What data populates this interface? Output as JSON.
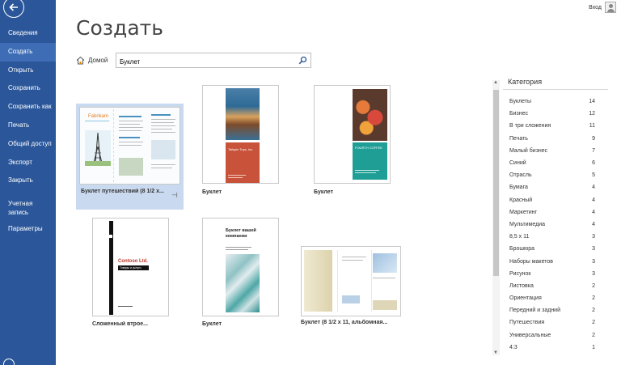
{
  "window": {
    "signin_label": "Вход"
  },
  "sidebar": {
    "items": [
      {
        "label": "Сведения"
      },
      {
        "label": "Создать",
        "active": true
      },
      {
        "label": "Открыть"
      },
      {
        "label": "Сохранить"
      },
      {
        "label": "Сохранить как"
      },
      {
        "label": "Печать"
      },
      {
        "label": "Общий доступ"
      },
      {
        "label": "Экспорт"
      },
      {
        "label": "Закрыть"
      },
      {
        "label": "Учетная запись",
        "two_line": true
      },
      {
        "label": "Параметры"
      }
    ]
  },
  "main": {
    "title": "Создать",
    "home_label": "Домой",
    "search_value": "Буклет",
    "templates": [
      {
        "caption": "Буклет путешествий (8 1/2 x...",
        "selected": true
      },
      {
        "caption": "Буклет"
      },
      {
        "caption": "Буклет"
      },
      {
        "caption": "Сложенный втрое..."
      },
      {
        "caption": "Буклет"
      },
      {
        "caption": "Буклет (8 1/2 x 11, альбомная..."
      }
    ],
    "thumb_text": {
      "fabrikam": "Fabrikam",
      "tailspin": "Tailspin Toys, Inc.",
      "fourth_coffee": "FOURTH COFFEE",
      "contoso": "Contoso Ltd.",
      "contoso_sub": "Товары и услуги",
      "booklet_heading": "Буклет вашей компании"
    }
  },
  "categories": {
    "title": "Категория",
    "items": [
      {
        "name": "Буклеты",
        "count": "14"
      },
      {
        "name": "Бизнес",
        "count": "12"
      },
      {
        "name": "В три сложения",
        "count": "11"
      },
      {
        "name": "Печать",
        "count": "9"
      },
      {
        "name": "Малый бизнес",
        "count": "7"
      },
      {
        "name": "Синий",
        "count": "6"
      },
      {
        "name": "Отрасль",
        "count": "5"
      },
      {
        "name": "Бумага",
        "count": "4"
      },
      {
        "name": "Красный",
        "count": "4"
      },
      {
        "name": "Маркетинг",
        "count": "4"
      },
      {
        "name": "Мультимедиа",
        "count": "4"
      },
      {
        "name": "8,5 x 11",
        "count": "3"
      },
      {
        "name": "Брошюра",
        "count": "3"
      },
      {
        "name": "Наборы макетов",
        "count": "3"
      },
      {
        "name": "Рисунок",
        "count": "3"
      },
      {
        "name": "Листовка",
        "count": "2"
      },
      {
        "name": "Ориентация",
        "count": "2"
      },
      {
        "name": "Передний и задний",
        "count": "2"
      },
      {
        "name": "Путешествия",
        "count": "2"
      },
      {
        "name": "Универсальные",
        "count": "2"
      },
      {
        "name": "4:3",
        "count": "1"
      }
    ]
  },
  "colors": {
    "sidebar": "#2b579a",
    "sidebar_active": "#3e6db5",
    "selection": "#c9d9ef"
  }
}
